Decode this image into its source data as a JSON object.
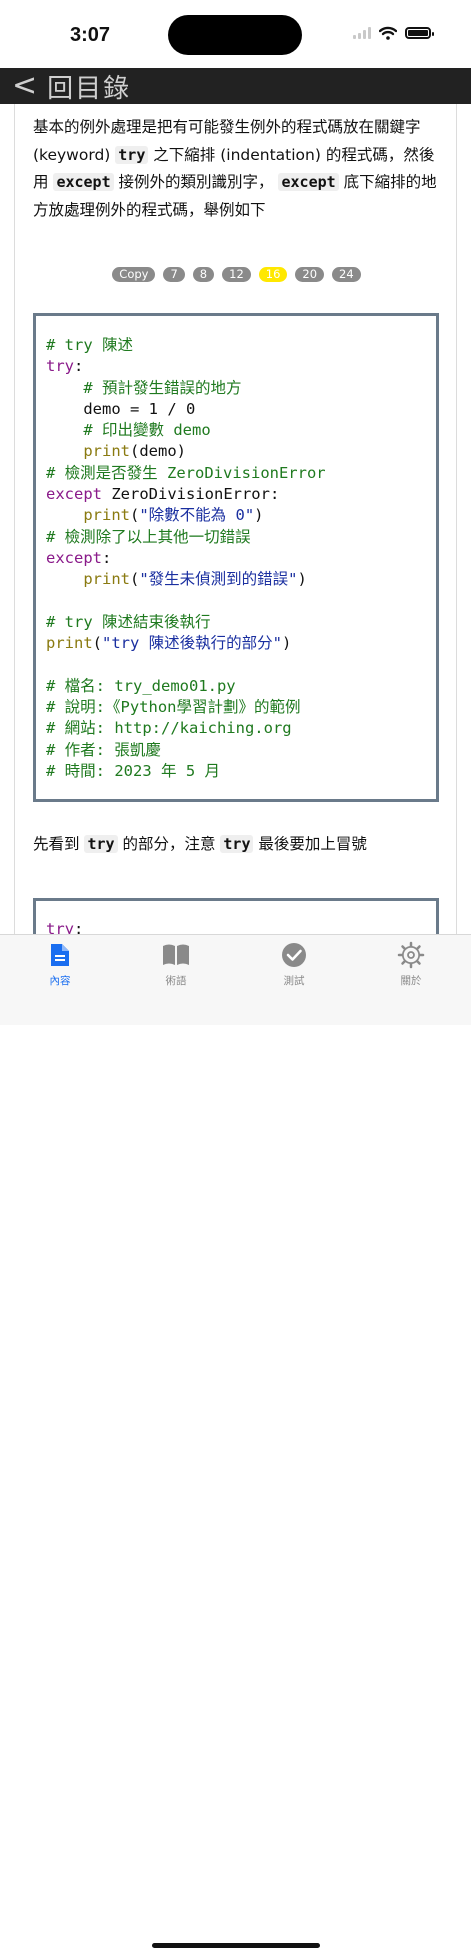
{
  "status": {
    "time": "3:07"
  },
  "nav": {
    "back_chevron": "<",
    "back_label": "回目錄"
  },
  "intro": {
    "t1": "基本的例外處理是把有可能發生例外的程式碼放在關鍵字 (keyword) ",
    "kw1": "try",
    "t2": " 之下縮排 (indentation) 的程式碼，然後用 ",
    "kw2": "except",
    "t3": " 接例外的類別識別字， ",
    "kw3": "except",
    "t4": " 底下縮排的地方放處理例外的程式碼，舉例如下"
  },
  "buttons": [
    "Copy",
    "7",
    "8",
    "12",
    "16",
    "20",
    "24"
  ],
  "active_button": "16",
  "code": [
    [
      {
        "t": "# try 陳述",
        "c": "cm"
      }
    ],
    [
      {
        "t": "try",
        "c": "kw"
      },
      {
        "t": ":",
        "c": "tx"
      }
    ],
    [
      {
        "t": "    # 預計發生錯誤的地方",
        "c": "cm"
      }
    ],
    [
      {
        "t": "    demo = 1 / 0",
        "c": "tx"
      }
    ],
    [
      {
        "t": "    # 印出變數 demo",
        "c": "cm"
      }
    ],
    [
      {
        "t": "    ",
        "c": "tx"
      },
      {
        "t": "print",
        "c": "fn"
      },
      {
        "t": "(demo)",
        "c": "tx"
      }
    ],
    [
      {
        "t": "# 檢測是否發生 ZeroDivisionError",
        "c": "cm"
      }
    ],
    [
      {
        "t": "except",
        "c": "kw"
      },
      {
        "t": " ZeroDivisionError:",
        "c": "tx"
      }
    ],
    [
      {
        "t": "    ",
        "c": "tx"
      },
      {
        "t": "print",
        "c": "fn"
      },
      {
        "t": "(",
        "c": "tx"
      },
      {
        "t": "\"除數不能為 0\"",
        "c": "st"
      },
      {
        "t": ")",
        "c": "tx"
      }
    ],
    [
      {
        "t": "# 檢測除了以上其他一切錯誤",
        "c": "cm"
      }
    ],
    [
      {
        "t": "except",
        "c": "kw"
      },
      {
        "t": ":",
        "c": "tx"
      }
    ],
    [
      {
        "t": "    ",
        "c": "tx"
      },
      {
        "t": "print",
        "c": "fn"
      },
      {
        "t": "(",
        "c": "tx"
      },
      {
        "t": "\"發生未偵測到的錯誤\"",
        "c": "st"
      },
      {
        "t": ")",
        "c": "tx"
      }
    ],
    [
      {
        "t": "",
        "c": "tx"
      }
    ],
    [
      {
        "t": "# try 陳述結束後執行",
        "c": "cm"
      }
    ],
    [
      {
        "t": "print",
        "c": "fn"
      },
      {
        "t": "(",
        "c": "tx"
      },
      {
        "t": "\"try 陳述後執行的部分\"",
        "c": "st"
      },
      {
        "t": ")",
        "c": "tx"
      }
    ],
    [
      {
        "t": "",
        "c": "tx"
      }
    ],
    [
      {
        "t": "# 檔名: try_demo01.py",
        "c": "cm"
      }
    ],
    [
      {
        "t": "# 說明:《Python學習計劃》的範例",
        "c": "cm"
      }
    ],
    [
      {
        "t": "# 網站: http://kaiching.org",
        "c": "cm"
      }
    ],
    [
      {
        "t": "# 作者: 張凱慶",
        "c": "cm"
      }
    ],
    [
      {
        "t": "# 時間: 2023 年 5 月",
        "c": "cm"
      }
    ]
  ],
  "para2": {
    "t1": "先看到 ",
    "kw1": "try",
    "t2": " 的部分，注意 ",
    "kw2": "try",
    "t3": " 最後要加上冒號"
  },
  "code2": [
    [
      {
        "t": "try",
        "c": "kw"
      },
      {
        "t": ":",
        "c": "tx"
      }
    ]
  ],
  "tabs": [
    {
      "label": "內容",
      "icon": "document-icon",
      "active": true
    },
    {
      "label": "術語",
      "icon": "book-icon",
      "active": false
    },
    {
      "label": "測試",
      "icon": "checkmark-circle-icon",
      "active": false
    },
    {
      "label": "關於",
      "icon": "gear-icon",
      "active": false
    }
  ],
  "colors": {
    "active_tab": "#1a6ef0",
    "active_pill": "#ffe800",
    "navbar": "#222222"
  }
}
